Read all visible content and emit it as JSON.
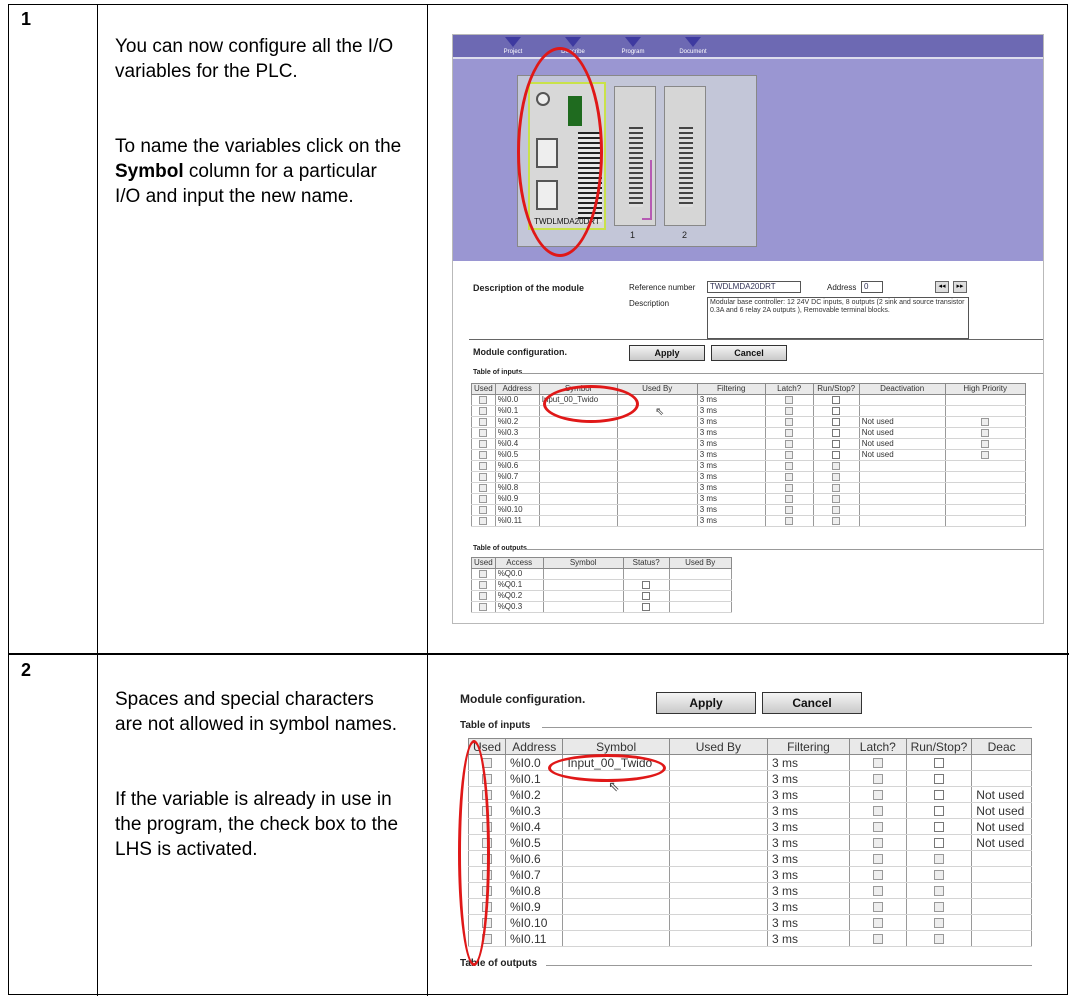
{
  "steps": [
    {
      "number": "1",
      "para1": "You can now configure all the I/O variables for the PLC.",
      "para2_pre": "To name the variables click on the ",
      "para2_bold": "Symbol",
      "para2_post": " column for a particular I/O and input the new name."
    },
    {
      "number": "2",
      "para1": "Spaces and special characters are not allowed in symbol names.",
      "para2": "If the variable is already in use in the program, the check box to the LHS is activated."
    }
  ],
  "shot1": {
    "tabs": [
      "Project",
      "Describe",
      "Program",
      "Document"
    ],
    "plc_label": "TWDLMDA20DRT",
    "slot_numbers": [
      "1",
      "2"
    ],
    "desc_section": "Description of the module",
    "ref_label": "Reference number",
    "ref_value": "TWDLMDA20DRT",
    "address_label": "Address",
    "address_value": "0",
    "description_label": "Description",
    "description_text": "Modular base controller: 12 24V DC inputs, 8 outputs (2 sink and source transistor 0.3A and 6 relay 2A outputs ), Removable terminal blocks.",
    "module_config": "Module configuration.",
    "apply": "Apply",
    "cancel": "Cancel",
    "inputs_title": "Table of inputs",
    "outputs_title": "Table of outputs",
    "input_headers": [
      "Used",
      "Address",
      "Symbol",
      "Used By",
      "Filtering",
      "Latch?",
      "Run/Stop?",
      "Deactivation",
      "High Priority"
    ],
    "input_rows": [
      {
        "address": "%I0.0",
        "symbol": "Input_00_Twido",
        "filtering": "3 ms",
        "deact": ""
      },
      {
        "address": "%I0.1",
        "symbol": "",
        "filtering": "3 ms",
        "deact": ""
      },
      {
        "address": "%I0.2",
        "symbol": "",
        "filtering": "3 ms",
        "deact": "Not used"
      },
      {
        "address": "%I0.3",
        "symbol": "",
        "filtering": "3 ms",
        "deact": "Not used"
      },
      {
        "address": "%I0.4",
        "symbol": "",
        "filtering": "3 ms",
        "deact": "Not used"
      },
      {
        "address": "%I0.5",
        "symbol": "",
        "filtering": "3 ms",
        "deact": "Not used"
      },
      {
        "address": "%I0.6",
        "symbol": "",
        "filtering": "3 ms",
        "deact": ""
      },
      {
        "address": "%I0.7",
        "symbol": "",
        "filtering": "3 ms",
        "deact": ""
      },
      {
        "address": "%I0.8",
        "symbol": "",
        "filtering": "3 ms",
        "deact": ""
      },
      {
        "address": "%I0.9",
        "symbol": "",
        "filtering": "3 ms",
        "deact": ""
      },
      {
        "address": "%I0.10",
        "symbol": "",
        "filtering": "3 ms",
        "deact": ""
      },
      {
        "address": "%I0.11",
        "symbol": "",
        "filtering": "3 ms",
        "deact": ""
      }
    ],
    "output_headers": [
      "Used",
      "Access",
      "Symbol",
      "Status?",
      "Used By"
    ],
    "output_rows": [
      "%Q0.0",
      "%Q0.1",
      "%Q0.2",
      "%Q0.3"
    ]
  },
  "shot2": {
    "module_config": "Module configuration.",
    "apply": "Apply",
    "cancel": "Cancel",
    "inputs_title": "Table of inputs",
    "outputs_title": "Table of outputs",
    "headers": [
      "Used",
      "Address",
      "Symbol",
      "Used By",
      "Filtering",
      "Latch?",
      "Run/Stop?",
      "Deac"
    ],
    "rows": [
      {
        "address": "%I0.0",
        "symbol": "Input_00_Twido",
        "filtering": "3 ms",
        "deact": ""
      },
      {
        "address": "%I0.1",
        "symbol": "",
        "filtering": "3 ms",
        "deact": ""
      },
      {
        "address": "%I0.2",
        "symbol": "",
        "filtering": "3 ms",
        "deact": "Not used"
      },
      {
        "address": "%I0.3",
        "symbol": "",
        "filtering": "3 ms",
        "deact": "Not used"
      },
      {
        "address": "%I0.4",
        "symbol": "",
        "filtering": "3 ms",
        "deact": "Not used"
      },
      {
        "address": "%I0.5",
        "symbol": "",
        "filtering": "3 ms",
        "deact": "Not used"
      },
      {
        "address": "%I0.6",
        "symbol": "",
        "filtering": "3 ms",
        "deact": ""
      },
      {
        "address": "%I0.7",
        "symbol": "",
        "filtering": "3 ms",
        "deact": ""
      },
      {
        "address": "%I0.8",
        "symbol": "",
        "filtering": "3 ms",
        "deact": ""
      },
      {
        "address": "%I0.9",
        "symbol": "",
        "filtering": "3 ms",
        "deact": ""
      },
      {
        "address": "%I0.10",
        "symbol": "",
        "filtering": "3 ms",
        "deact": ""
      },
      {
        "address": "%I0.11",
        "symbol": "",
        "filtering": "3 ms",
        "deact": ""
      }
    ]
  },
  "colors": {
    "highlight_oval": "#e01818",
    "panel_purple": "#9a96d2"
  }
}
